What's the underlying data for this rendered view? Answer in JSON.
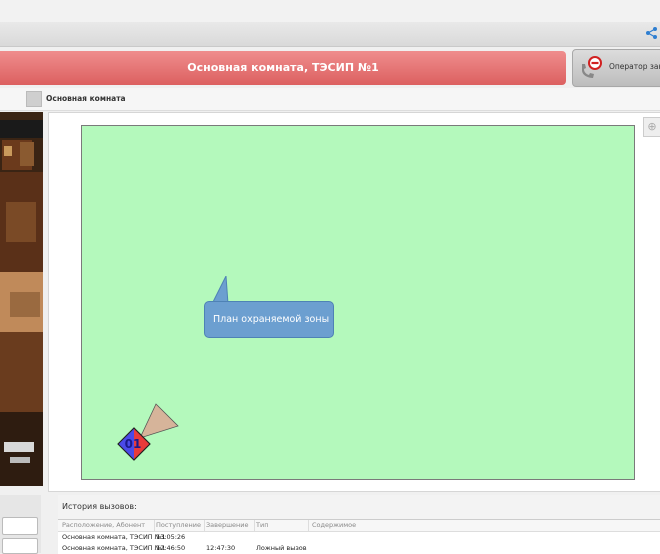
{
  "window": {
    "top_icon": "network-icon"
  },
  "alarm": {
    "title": "Основная комната, ТЭСИП №1"
  },
  "operator": {
    "label": "Оператор занят",
    "icon": "busy-phone-icon"
  },
  "tab": {
    "label": "Основная комната"
  },
  "map": {
    "callout_label": "План охраняемой зоны",
    "sensor_number": "01",
    "zone_color": "#b4f9bc"
  },
  "history": {
    "title": "История вызовов:",
    "columns": [
      "Расположение, Абонент",
      "Поступление",
      "Завершение",
      "Тип",
      "Содержимое"
    ],
    "rows": [
      [
        "Основная комната, ТЭСИП №1",
        "13:05:26",
        "",
        "",
        ""
      ],
      [
        "Основная комната, ТЭСИП №1",
        "12:46:50",
        "12:47:30",
        "Ложный вызов",
        ""
      ]
    ]
  },
  "colors": {
    "alarm_red": "#e07070",
    "accent_blue": "#6c9fd0"
  }
}
